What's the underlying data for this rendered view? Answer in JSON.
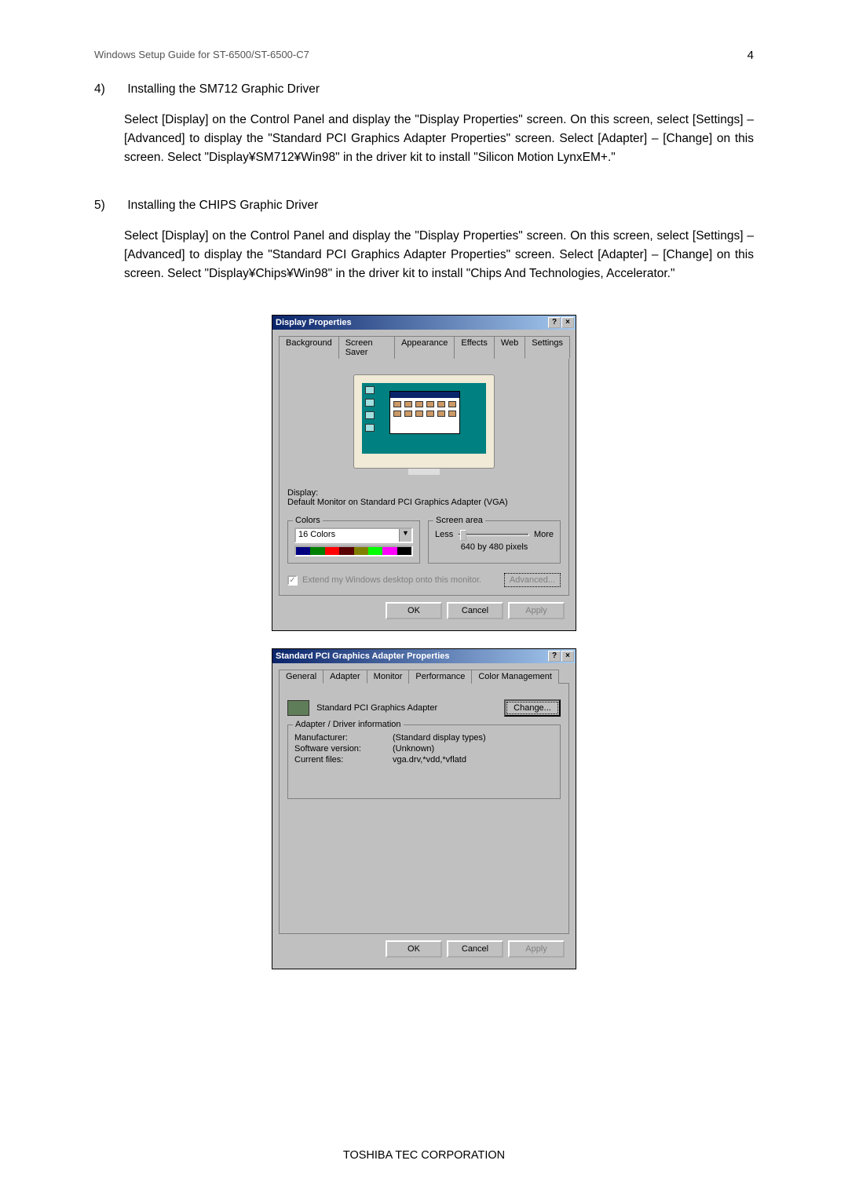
{
  "header": "Windows Setup Guide for ST-6500/ST-6500-C7",
  "page_number": "4",
  "section4": {
    "num": "4)",
    "title": "Installing the SM712 Graphic Driver",
    "body": "Select [Display] on the Control Panel and display the \"Display Properties\" screen.  On this screen, select [Settings] – [Advanced] to display the \"Standard PCI Graphics Adapter Properties\" screen.    Select [Adapter] – [Change] on this screen.    Select \"Display¥SM712¥Win98\" in the driver kit to install \"Silicon Motion LynxEM+.\""
  },
  "section5": {
    "num": "5)",
    "title": "Installing the CHIPS Graphic Driver",
    "body": "Select [Display] on the Control Panel and display the \"Display Properties\" screen.  On this screen, select [Settings] – [Advanced] to display the \"Standard PCI Graphics Adapter Properties\" screen.    Select [Adapter] – [Change] on this screen.    Select \"Display¥Chips¥Win98\" in the driver kit to install \"Chips And Technologies, Accelerator.\""
  },
  "dialog1": {
    "title": "Display Properties",
    "tabs": [
      "Background",
      "Screen Saver",
      "Appearance",
      "Effects",
      "Web",
      "Settings"
    ],
    "display_label": "Display:",
    "display_value": "Default Monitor on Standard PCI Graphics Adapter (VGA)",
    "colors_legend": "Colors",
    "colors_value": "16 Colors",
    "screen_area_legend": "Screen area",
    "less": "Less",
    "more": "More",
    "resolution": "640 by 480 pixels",
    "extend_label": "Extend my Windows desktop onto this monitor.",
    "advanced": "Advanced...",
    "ok": "OK",
    "cancel": "Cancel",
    "apply": "Apply"
  },
  "dialog2": {
    "title": "Standard PCI Graphics Adapter Properties",
    "tabs": [
      "General",
      "Adapter",
      "Monitor",
      "Performance",
      "Color Management"
    ],
    "adapter_name": "Standard PCI Graphics Adapter",
    "change": "Change...",
    "group_legend": "Adapter / Driver information",
    "manufacturer_label": "Manufacturer:",
    "manufacturer_value": "(Standard display types)",
    "software_label": "Software version:",
    "software_value": "(Unknown)",
    "files_label": "Current files:",
    "files_value": "vga.drv,*vdd,*vflatd",
    "ok": "OK",
    "cancel": "Cancel",
    "apply": "Apply"
  },
  "footer": "TOSHIBA TEC CORPORATION"
}
